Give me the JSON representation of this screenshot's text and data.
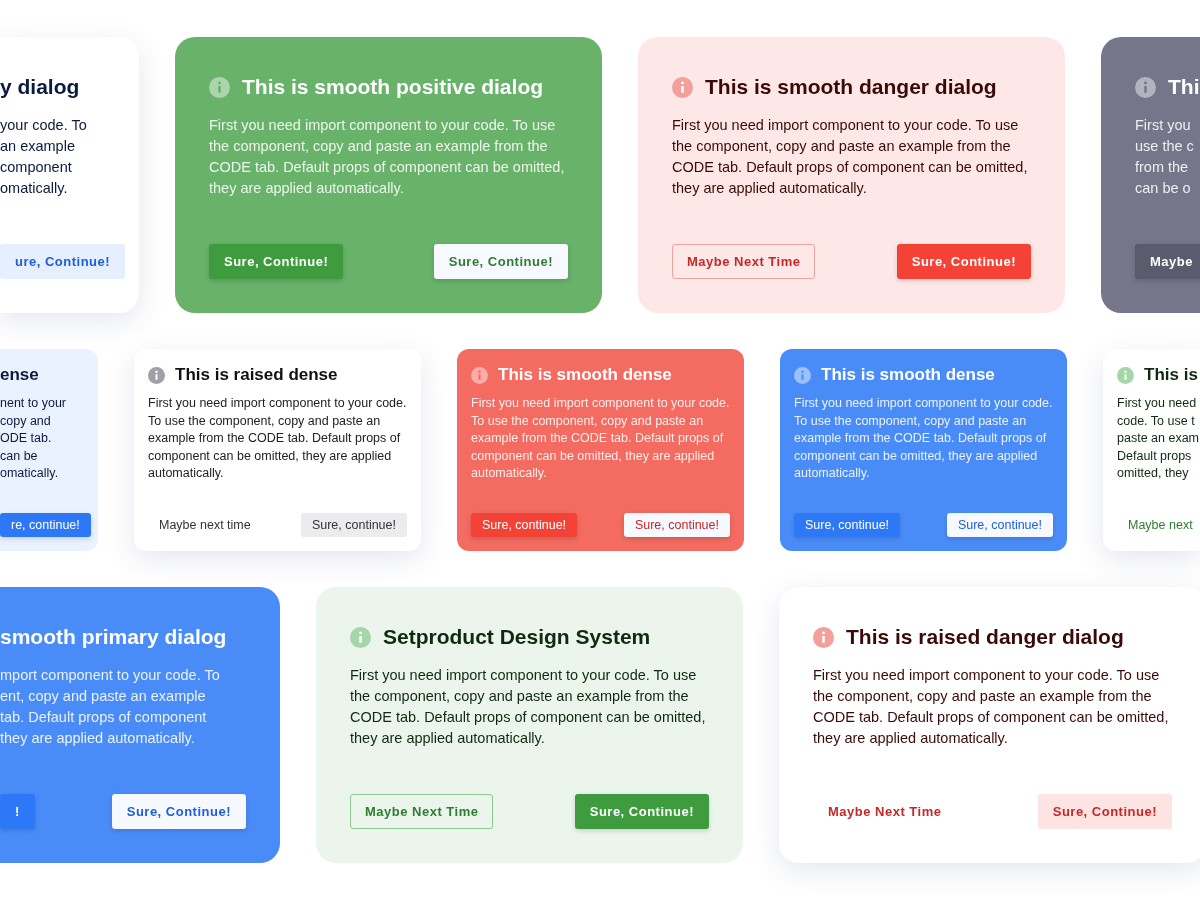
{
  "rows": [
    {
      "kind": "large",
      "cards": [
        {
          "kind": "primary-raised",
          "cut_left": true,
          "icon": false,
          "title": "y dialog",
          "body": "your code. To\nan example\ncomponent\nomatically.",
          "buttons": [
            {
              "label": "ure, Continue!",
              "kind": "tinted"
            }
          ]
        },
        {
          "kind": "positive-solid",
          "icon": true,
          "title": "This is smooth positive dialog",
          "body": "First you need import component to your code. To use the component, copy and paste an example from the CODE tab. Default props of component can be omitted, they are applied automatically.",
          "buttons": [
            {
              "label": "Sure, Continue!",
              "kind": "solid"
            },
            {
              "label": "Sure, Continue!",
              "kind": "light"
            }
          ]
        },
        {
          "kind": "danger-tinted",
          "icon": true,
          "title": "This is smooth danger dialog",
          "body": "First you need import component to your code. To use the component, copy and paste an example from the CODE tab. Default props of component can be omitted, they are applied automatically.",
          "buttons": [
            {
              "label": "Maybe Next Time",
              "kind": "outline"
            },
            {
              "label": "Sure, Continue!",
              "kind": "solid"
            }
          ]
        },
        {
          "kind": "neutral-solid",
          "cut_right": true,
          "icon": true,
          "title": "Thi",
          "body": "First you\nuse the c\nfrom the\ncan be o",
          "buttons": [
            {
              "label": "Maybe",
              "kind": "solid"
            }
          ]
        }
      ]
    },
    {
      "kind": "dense",
      "cards": [
        {
          "kind": "primary-tinted",
          "cut_left": true,
          "icon": false,
          "title": "ense",
          "body": "nent to your\ncopy and\nODE tab.\ncan be\nomatically.",
          "buttons": [
            {
              "label": "re, continue!",
              "kind": "solid"
            }
          ]
        },
        {
          "kind": "neutral-raised",
          "icon": true,
          "title": "This is raised dense",
          "body": "First you need import component to your code. To use the component, copy and paste an example from the CODE tab. Default props of component can be omitted, they are applied automatically.",
          "buttons": [
            {
              "label": "Maybe next time",
              "kind": "text"
            },
            {
              "label": "Sure, continue!",
              "kind": "tinted"
            }
          ]
        },
        {
          "kind": "danger-solid",
          "icon": true,
          "title": "This is smooth dense",
          "body": "First you need import component to your code. To use the component, copy and paste an example from the CODE tab. Default props of component can be omitted, they are applied automatically.",
          "buttons": [
            {
              "label": "Sure, continue!",
              "kind": "solid"
            },
            {
              "label": "Sure, continue!",
              "kind": "light"
            }
          ]
        },
        {
          "kind": "primary-solid",
          "icon": true,
          "title": "This is smooth dense",
          "body": "First you need import component to your code. To use the component, copy and paste an example from the CODE tab. Default props of component can be omitted, they are applied automatically.",
          "buttons": [
            {
              "label": "Sure, continue!",
              "kind": "solid"
            },
            {
              "label": "Sure, continue!",
              "kind": "light"
            }
          ]
        },
        {
          "kind": "positive-raised",
          "cut_right": true,
          "icon": true,
          "title": "This is",
          "body": "First you need\ncode. To use t\npaste an exam\nDefault props\nomitted, they",
          "buttons": [
            {
              "label": "Maybe next",
              "kind": "text"
            }
          ]
        }
      ]
    },
    {
      "kind": "large",
      "cards": [
        {
          "kind": "primary-solid",
          "cut_left": true,
          "icon": false,
          "title": "smooth primary dialog",
          "body": "mport component to your code. To\nent, copy and paste an example\ntab. Default props of component\nthey are applied automatically.",
          "buttons": [
            {
              "label": "!",
              "kind": "solid"
            },
            {
              "label": "Sure, Continue!",
              "kind": "light"
            }
          ]
        },
        {
          "kind": "positive-tinted",
          "icon": true,
          "title": "Setproduct Design System",
          "body": "First you need import component to your code. To use the component, copy and paste an example from the CODE tab. Default props of component can be omitted, they are applied automatically.",
          "buttons": [
            {
              "label": "Maybe Next Time",
              "kind": "outline"
            },
            {
              "label": "Sure, Continue!",
              "kind": "solid"
            }
          ]
        },
        {
          "kind": "danger-raised",
          "icon": true,
          "title": "This is raised danger dialog",
          "body": "First you need import component to your code. To use the component, copy and paste an example from the CODE tab. Default props of component can be omitted, they are applied automatically.",
          "buttons": [
            {
              "label": "Maybe Next Time",
              "kind": "text"
            },
            {
              "label": "Sure, Continue!",
              "kind": "tinted"
            }
          ]
        }
      ]
    }
  ]
}
